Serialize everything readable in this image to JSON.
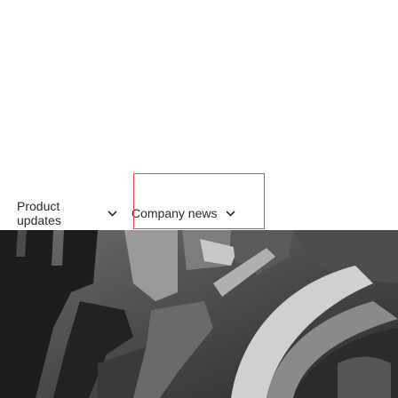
{
  "nav": {
    "tabs": [
      {
        "label": "Product updates",
        "icon": "chevron-down-icon"
      },
      {
        "label": "Company news",
        "icon": "chevron-down-icon"
      }
    ],
    "highlight_color": "#e8434d"
  },
  "hero": {
    "image": "dark grayscale photo"
  }
}
